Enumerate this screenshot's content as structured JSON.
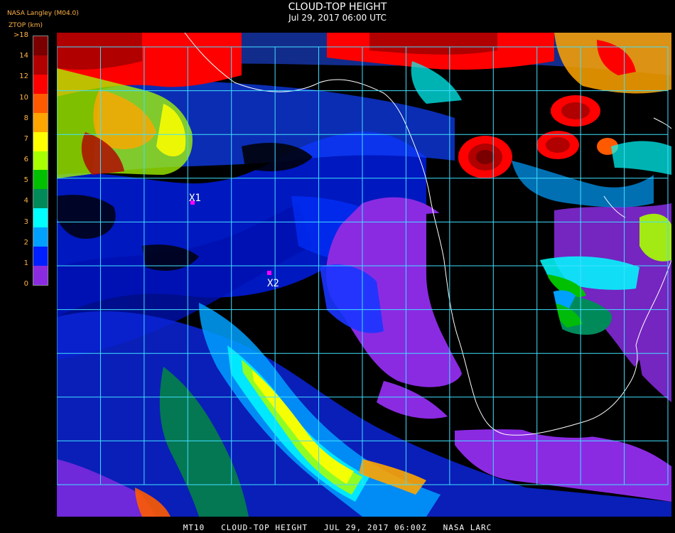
{
  "header": {
    "title": "CLOUD-TOP HEIGHT",
    "subtitle": "Jul 29, 2017 06:00 UTC",
    "org_label": "NASA Langley (M04.0)",
    "units_label": "ZTOP (km)"
  },
  "legend": {
    "labels": [
      ">18",
      "14",
      "12",
      "10",
      "8",
      "7",
      "6",
      "5",
      "4",
      "3",
      "2",
      "1",
      "0"
    ],
    "colors": [
      "#7a0000",
      "#b00000",
      "#ff0000",
      "#ff5a00",
      "#ffa500",
      "#ffff00",
      "#a8ff00",
      "#00c000",
      "#008a5a",
      "#00ffff",
      "#00a0ff",
      "#0020ff",
      "#8a2be2"
    ]
  },
  "markers": [
    {
      "label": "X1"
    },
    {
      "label": "X2"
    }
  ],
  "footer": "MT10   CLOUD-TOP HEIGHT   JUL 29, 2017 06:00Z   NASA LARC",
  "colors": {
    "grid": "#40e0ff",
    "coast": "#ffffff",
    "marker": "#ff00ff",
    "background": "#000000"
  }
}
